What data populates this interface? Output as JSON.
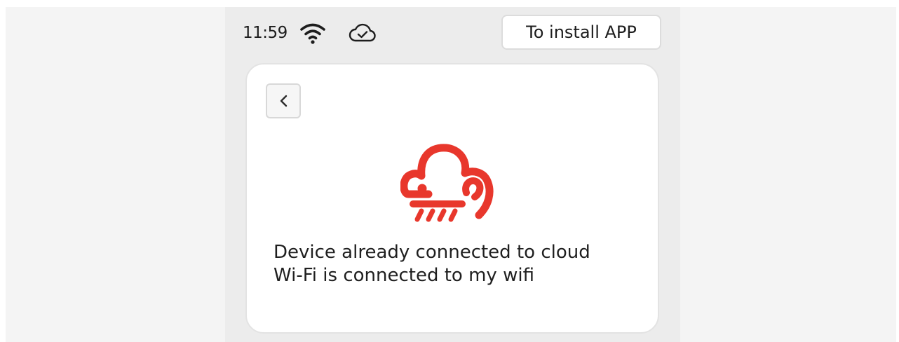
{
  "status_bar": {
    "time": "11:59",
    "wifi_icon": "wifi-icon",
    "cloud_icon": "cloud-check-icon"
  },
  "header": {
    "install_button_label": "To install APP"
  },
  "card": {
    "back_icon": "chevron-left-icon",
    "logo_icon": "cloud-logo-icon",
    "messages": [
      "Device already connected to cloud",
      "Wi-Fi is connected to my wifi"
    ]
  },
  "colors": {
    "accent": "#e8372c",
    "screen_bg": "#ececec",
    "card_bg": "#ffffff",
    "text": "#1f1f1f"
  }
}
